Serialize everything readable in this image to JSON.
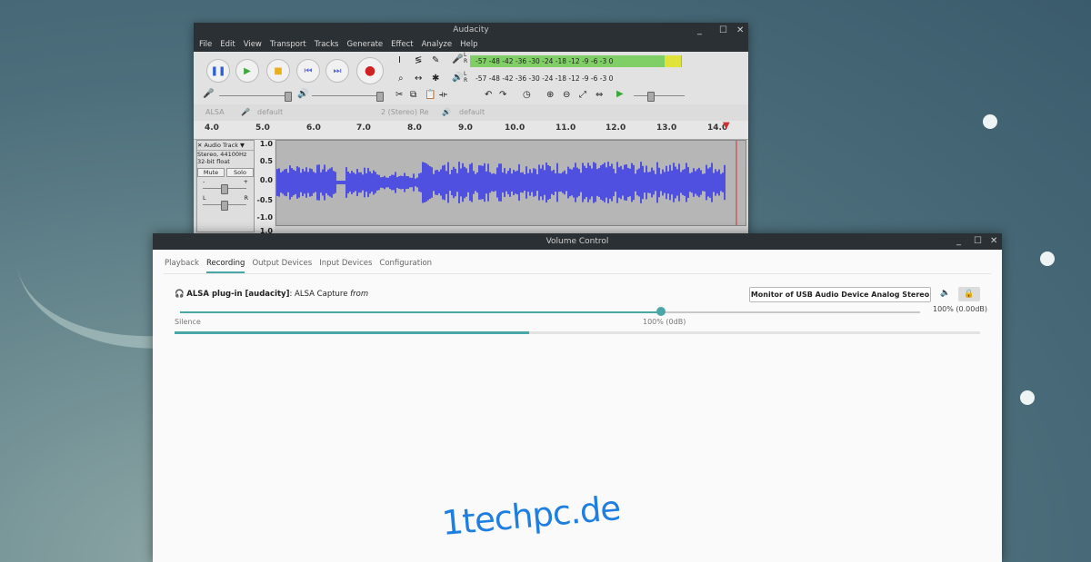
{
  "audacity": {
    "title": "Audacity",
    "window_controls": [
      "_",
      "☐",
      "✕"
    ],
    "menu": [
      "File",
      "Edit",
      "View",
      "Transport",
      "Tracks",
      "Generate",
      "Effect",
      "Analyze",
      "Help"
    ],
    "meter_record_scale": "-57 -48 -42 -36 -30 -24 -18 -12 -9 -6 -3 0",
    "meter_play_scale": "-57 -48 -42 -36 -30 -24 -18 -12 -9 -6 -3 0",
    "meter_lr_rec": "L\nR",
    "meter_lr_play": "L\nR",
    "device_host": "ALSA",
    "device_rec": "default",
    "device_channels": "2 (Stereo) Re",
    "device_play": "default",
    "ruler": [
      "4.0",
      "5.0",
      "6.0",
      "7.0",
      "8.0",
      "9.0",
      "10.0",
      "11.0",
      "12.0",
      "13.0",
      "14.0"
    ],
    "track_name": "Audio Track",
    "track_format": "Stereo, 44100Hz",
    "track_bits": "32-bit float",
    "mute_label": "Mute",
    "solo_label": "Solo",
    "gain_minus": "-",
    "gain_plus": "+",
    "pan_l": "L",
    "pan_r": "R",
    "vscale": [
      "1.0",
      "0.5",
      "0.0",
      "-0.5",
      "-1.0",
      "1.0"
    ],
    "accent": "#5050e0"
  },
  "volume": {
    "title": "Volume Control",
    "window_controls": [
      "_",
      "☐",
      "✕"
    ],
    "tabs": [
      "Playback",
      "Recording",
      "Output Devices",
      "Input Devices",
      "Configuration"
    ],
    "active_tab": "Recording",
    "stream_app": "ALSA plug-in [audacity]",
    "stream_desc": ": ALSA Capture ",
    "stream_from": "from",
    "device": "Monitor of USB Audio Device Analog Stereo",
    "volume_value": "100% (0.00dB)",
    "silence_label": "Silence",
    "hundred_label": "100% (0dB)",
    "volume_fraction": 0.65,
    "peak_fraction": 0.44,
    "accent": "#4aa7a8"
  },
  "watermark": "1techpc.de"
}
